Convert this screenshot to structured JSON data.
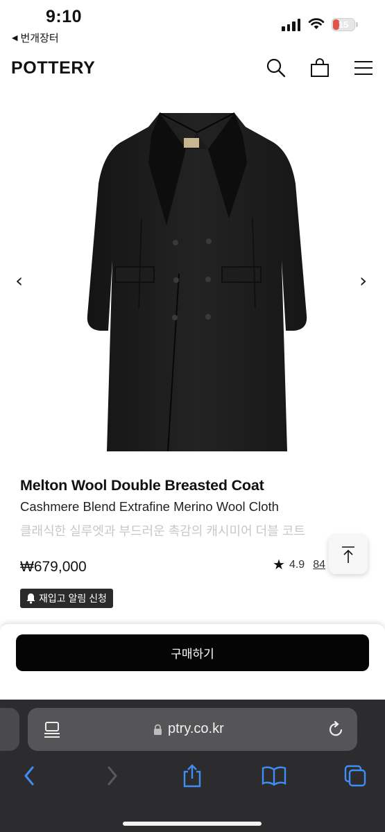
{
  "status_bar": {
    "time": "9:10",
    "back_app": "번개장터",
    "battery_level": "15",
    "colors": {
      "battery_low": "#e0554a"
    }
  },
  "header": {
    "logo": "POTTERY",
    "icons": [
      "search-icon",
      "shopping-bag-icon",
      "menu-icon"
    ]
  },
  "carousel": {
    "prev_label": "‹",
    "next_label": "›"
  },
  "product": {
    "name": "Melton Wool Double Breasted Coat",
    "subtitle": "Cashmere Blend Extrafine Merino Wool Cloth",
    "description": "클래식한 실루엣과 부드러운 촉감의 캐시미어 더블 코트",
    "price": "₩679,000",
    "rating": "4.9",
    "reviews": "84",
    "restock_label": "재입고 알림 신청"
  },
  "actions": {
    "buy_label": "구매하기",
    "colors": {
      "buy_bg": "#050505",
      "buy_text": "#ffffff"
    }
  },
  "browser": {
    "url": "ptry.co.kr",
    "toolbar_icons": [
      "back-icon",
      "forward-icon",
      "share-icon",
      "bookmarks-icon",
      "tabs-icon"
    ]
  }
}
